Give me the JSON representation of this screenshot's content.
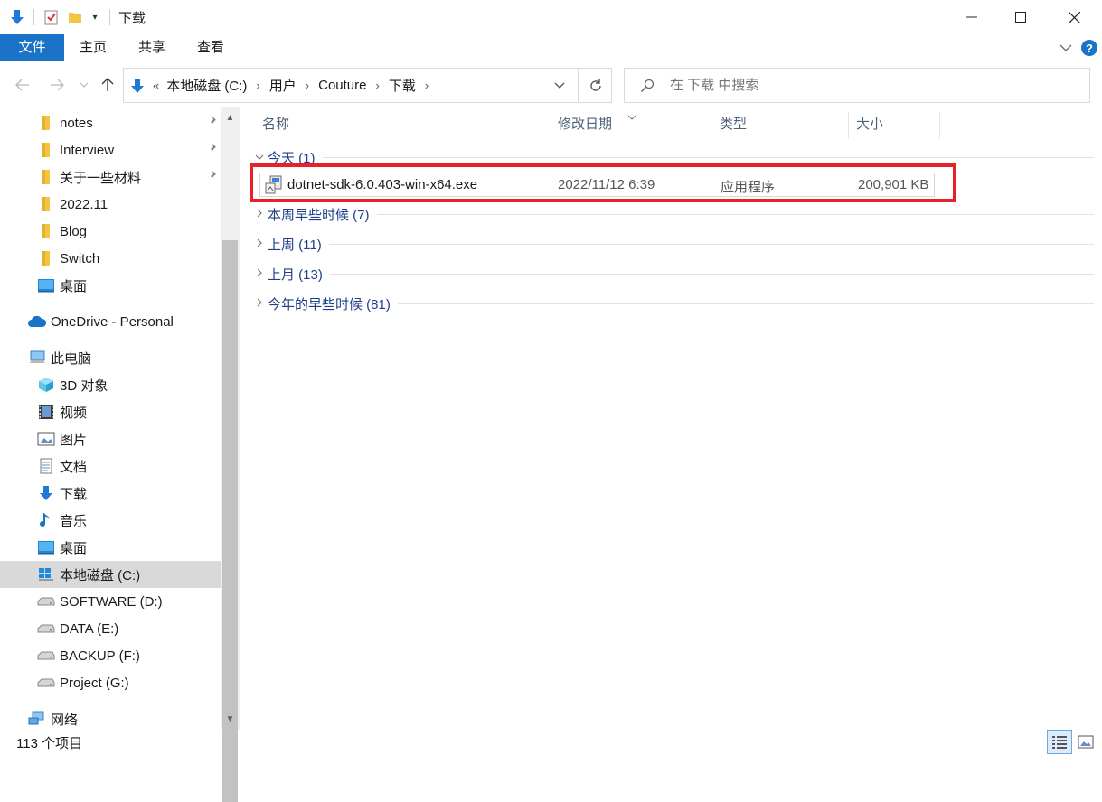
{
  "window": {
    "title": "下载",
    "minimize_icon": "minimize-icon",
    "maximize_icon": "maximize-icon",
    "close_icon": "close-icon"
  },
  "ribbon": {
    "tabs": [
      "文件",
      "主页",
      "共享",
      "查看"
    ]
  },
  "address": {
    "prefix": "«",
    "crumbs": [
      "本地磁盘 (C:)",
      "用户",
      "Couture",
      "下载"
    ]
  },
  "search": {
    "placeholder": "在 下载 中搜索"
  },
  "sidebar": {
    "quick_access": [
      {
        "label": "notes",
        "icon": "folder-icon",
        "pinned": true
      },
      {
        "label": "Interview",
        "icon": "folder-icon",
        "pinned": true
      },
      {
        "label": "关于一些材料",
        "icon": "folder-icon",
        "pinned": true
      },
      {
        "label": "2022.11",
        "icon": "folder-icon",
        "pinned": false
      },
      {
        "label": "Blog",
        "icon": "folder-icon",
        "pinned": false
      },
      {
        "label": "Switch",
        "icon": "folder-icon",
        "pinned": false
      },
      {
        "label": "桌面",
        "icon": "desktop-icon",
        "pinned": false
      }
    ],
    "onedrive": "OneDrive - Personal",
    "this_pc": "此电脑",
    "pc_items": [
      {
        "label": "3D 对象",
        "icon": "cube-3d-icon"
      },
      {
        "label": "视频",
        "icon": "video-icon"
      },
      {
        "label": "图片",
        "icon": "pictures-icon"
      },
      {
        "label": "文档",
        "icon": "document-icon"
      },
      {
        "label": "下载",
        "icon": "download-icon"
      },
      {
        "label": "音乐",
        "icon": "music-icon"
      },
      {
        "label": "桌面",
        "icon": "desktop-icon"
      },
      {
        "label": "本地磁盘 (C:)",
        "icon": "windows-drive-icon",
        "selected": true
      },
      {
        "label": "SOFTWARE (D:)",
        "icon": "drive-icon"
      },
      {
        "label": "DATA (E:)",
        "icon": "drive-icon"
      },
      {
        "label": "BACKUP (F:)",
        "icon": "drive-icon"
      },
      {
        "label": "Project (G:)",
        "icon": "drive-icon"
      }
    ],
    "network": "网络"
  },
  "columns": {
    "name": "名称",
    "modified": "修改日期",
    "type": "类型",
    "size": "大小"
  },
  "groups": [
    {
      "label": "今天 (1)",
      "expanded": true
    },
    {
      "label": "本周早些时候 (7)",
      "expanded": false
    },
    {
      "label": "上周 (11)",
      "expanded": false
    },
    {
      "label": "上月 (13)",
      "expanded": false
    },
    {
      "label": "今年的早些时候 (81)",
      "expanded": false
    }
  ],
  "files": [
    {
      "name": "dotnet-sdk-6.0.403-win-x64.exe",
      "modified": "2022/11/12 6:39",
      "type": "应用程序",
      "size": "200,901 KB",
      "icon": "installer-exe-icon",
      "highlighted": true
    }
  ],
  "status": {
    "item_count": "113 个项目"
  },
  "colors": {
    "accent": "#1a73c7",
    "highlight_border": "#e8202a",
    "group_label": "#1e3f8a"
  }
}
